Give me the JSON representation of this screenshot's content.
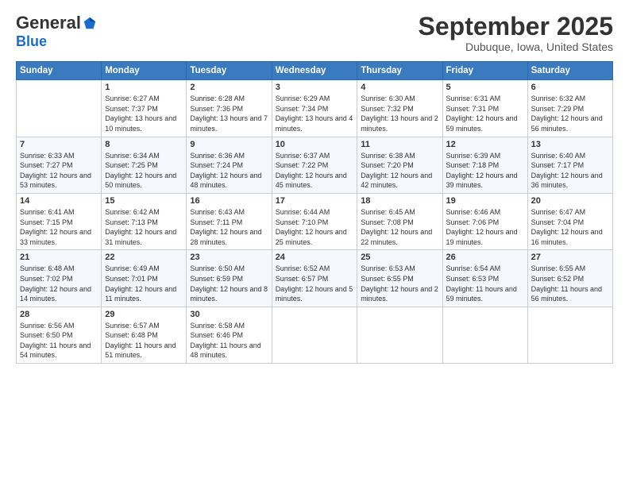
{
  "logo": {
    "general": "General",
    "blue": "Blue"
  },
  "header": {
    "month": "September 2025",
    "location": "Dubuque, Iowa, United States"
  },
  "weekdays": [
    "Sunday",
    "Monday",
    "Tuesday",
    "Wednesday",
    "Thursday",
    "Friday",
    "Saturday"
  ],
  "weeks": [
    [
      {
        "day": "",
        "sunrise": "",
        "sunset": "",
        "daylight": ""
      },
      {
        "day": "1",
        "sunrise": "Sunrise: 6:27 AM",
        "sunset": "Sunset: 7:37 PM",
        "daylight": "Daylight: 13 hours and 10 minutes."
      },
      {
        "day": "2",
        "sunrise": "Sunrise: 6:28 AM",
        "sunset": "Sunset: 7:36 PM",
        "daylight": "Daylight: 13 hours and 7 minutes."
      },
      {
        "day": "3",
        "sunrise": "Sunrise: 6:29 AM",
        "sunset": "Sunset: 7:34 PM",
        "daylight": "Daylight: 13 hours and 4 minutes."
      },
      {
        "day": "4",
        "sunrise": "Sunrise: 6:30 AM",
        "sunset": "Sunset: 7:32 PM",
        "daylight": "Daylight: 13 hours and 2 minutes."
      },
      {
        "day": "5",
        "sunrise": "Sunrise: 6:31 AM",
        "sunset": "Sunset: 7:31 PM",
        "daylight": "Daylight: 12 hours and 59 minutes."
      },
      {
        "day": "6",
        "sunrise": "Sunrise: 6:32 AM",
        "sunset": "Sunset: 7:29 PM",
        "daylight": "Daylight: 12 hours and 56 minutes."
      }
    ],
    [
      {
        "day": "7",
        "sunrise": "Sunrise: 6:33 AM",
        "sunset": "Sunset: 7:27 PM",
        "daylight": "Daylight: 12 hours and 53 minutes."
      },
      {
        "day": "8",
        "sunrise": "Sunrise: 6:34 AM",
        "sunset": "Sunset: 7:25 PM",
        "daylight": "Daylight: 12 hours and 50 minutes."
      },
      {
        "day": "9",
        "sunrise": "Sunrise: 6:36 AM",
        "sunset": "Sunset: 7:24 PM",
        "daylight": "Daylight: 12 hours and 48 minutes."
      },
      {
        "day": "10",
        "sunrise": "Sunrise: 6:37 AM",
        "sunset": "Sunset: 7:22 PM",
        "daylight": "Daylight: 12 hours and 45 minutes."
      },
      {
        "day": "11",
        "sunrise": "Sunrise: 6:38 AM",
        "sunset": "Sunset: 7:20 PM",
        "daylight": "Daylight: 12 hours and 42 minutes."
      },
      {
        "day": "12",
        "sunrise": "Sunrise: 6:39 AM",
        "sunset": "Sunset: 7:18 PM",
        "daylight": "Daylight: 12 hours and 39 minutes."
      },
      {
        "day": "13",
        "sunrise": "Sunrise: 6:40 AM",
        "sunset": "Sunset: 7:17 PM",
        "daylight": "Daylight: 12 hours and 36 minutes."
      }
    ],
    [
      {
        "day": "14",
        "sunrise": "Sunrise: 6:41 AM",
        "sunset": "Sunset: 7:15 PM",
        "daylight": "Daylight: 12 hours and 33 minutes."
      },
      {
        "day": "15",
        "sunrise": "Sunrise: 6:42 AM",
        "sunset": "Sunset: 7:13 PM",
        "daylight": "Daylight: 12 hours and 31 minutes."
      },
      {
        "day": "16",
        "sunrise": "Sunrise: 6:43 AM",
        "sunset": "Sunset: 7:11 PM",
        "daylight": "Daylight: 12 hours and 28 minutes."
      },
      {
        "day": "17",
        "sunrise": "Sunrise: 6:44 AM",
        "sunset": "Sunset: 7:10 PM",
        "daylight": "Daylight: 12 hours and 25 minutes."
      },
      {
        "day": "18",
        "sunrise": "Sunrise: 6:45 AM",
        "sunset": "Sunset: 7:08 PM",
        "daylight": "Daylight: 12 hours and 22 minutes."
      },
      {
        "day": "19",
        "sunrise": "Sunrise: 6:46 AM",
        "sunset": "Sunset: 7:06 PM",
        "daylight": "Daylight: 12 hours and 19 minutes."
      },
      {
        "day": "20",
        "sunrise": "Sunrise: 6:47 AM",
        "sunset": "Sunset: 7:04 PM",
        "daylight": "Daylight: 12 hours and 16 minutes."
      }
    ],
    [
      {
        "day": "21",
        "sunrise": "Sunrise: 6:48 AM",
        "sunset": "Sunset: 7:02 PM",
        "daylight": "Daylight: 12 hours and 14 minutes."
      },
      {
        "day": "22",
        "sunrise": "Sunrise: 6:49 AM",
        "sunset": "Sunset: 7:01 PM",
        "daylight": "Daylight: 12 hours and 11 minutes."
      },
      {
        "day": "23",
        "sunrise": "Sunrise: 6:50 AM",
        "sunset": "Sunset: 6:59 PM",
        "daylight": "Daylight: 12 hours and 8 minutes."
      },
      {
        "day": "24",
        "sunrise": "Sunrise: 6:52 AM",
        "sunset": "Sunset: 6:57 PM",
        "daylight": "Daylight: 12 hours and 5 minutes."
      },
      {
        "day": "25",
        "sunrise": "Sunrise: 6:53 AM",
        "sunset": "Sunset: 6:55 PM",
        "daylight": "Daylight: 12 hours and 2 minutes."
      },
      {
        "day": "26",
        "sunrise": "Sunrise: 6:54 AM",
        "sunset": "Sunset: 6:53 PM",
        "daylight": "Daylight: 11 hours and 59 minutes."
      },
      {
        "day": "27",
        "sunrise": "Sunrise: 6:55 AM",
        "sunset": "Sunset: 6:52 PM",
        "daylight": "Daylight: 11 hours and 56 minutes."
      }
    ],
    [
      {
        "day": "28",
        "sunrise": "Sunrise: 6:56 AM",
        "sunset": "Sunset: 6:50 PM",
        "daylight": "Daylight: 11 hours and 54 minutes."
      },
      {
        "day": "29",
        "sunrise": "Sunrise: 6:57 AM",
        "sunset": "Sunset: 6:48 PM",
        "daylight": "Daylight: 11 hours and 51 minutes."
      },
      {
        "day": "30",
        "sunrise": "Sunrise: 6:58 AM",
        "sunset": "Sunset: 6:46 PM",
        "daylight": "Daylight: 11 hours and 48 minutes."
      },
      {
        "day": "",
        "sunrise": "",
        "sunset": "",
        "daylight": ""
      },
      {
        "day": "",
        "sunrise": "",
        "sunset": "",
        "daylight": ""
      },
      {
        "day": "",
        "sunrise": "",
        "sunset": "",
        "daylight": ""
      },
      {
        "day": "",
        "sunrise": "",
        "sunset": "",
        "daylight": ""
      }
    ]
  ]
}
